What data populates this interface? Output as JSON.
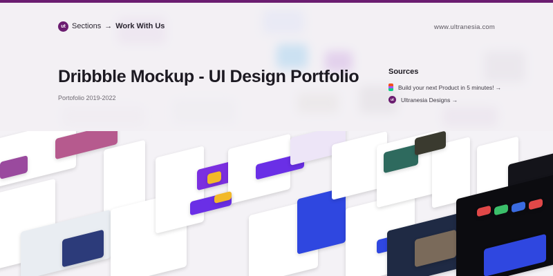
{
  "colors": {
    "accent": "#6b1d70",
    "dark": "#1d1a22",
    "blue": "#2f47e0",
    "yellow": "#f2b929"
  },
  "header": {
    "logo_text": "ut",
    "breadcrumb": {
      "parent": "Sections",
      "separator": "→",
      "current": "Work With Us"
    },
    "site_url": "www.ultranesia.com"
  },
  "hero": {
    "title": "Dribbble Mockup - UI Design Portfolio",
    "subtitle": "Portofolio 2019-2022"
  },
  "sources": {
    "heading": "Sources",
    "items": [
      {
        "label": "Build your next Product in 5 minutes! →",
        "icon": "figma-icon"
      },
      {
        "label": "Ultranesia Designs →",
        "icon": "ultranesia-logo-icon"
      }
    ]
  }
}
